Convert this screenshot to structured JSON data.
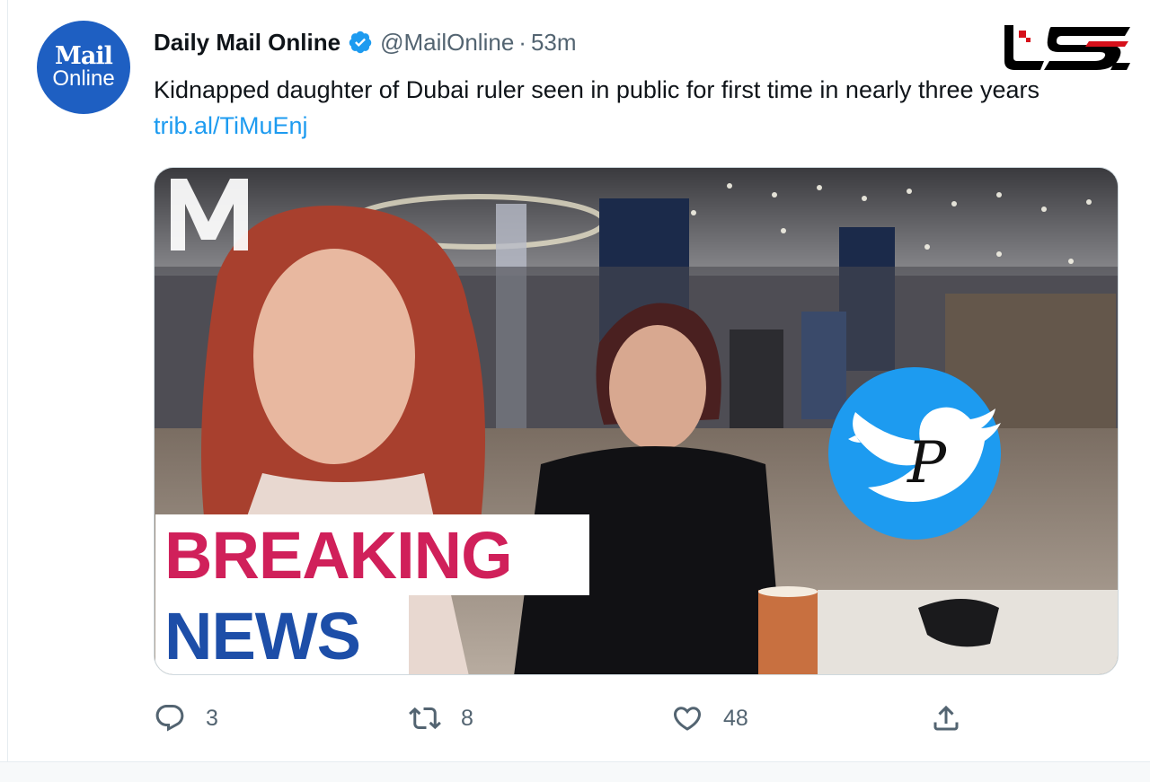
{
  "tweet": {
    "avatar": {
      "line1": "Mail",
      "line2": "Online"
    },
    "display_name": "Daily Mail Online",
    "handle": "@MailOnline",
    "separator": "·",
    "time": "53m",
    "text": "Kidnapped daughter of Dubai ruler seen in public for first time in nearly three years ",
    "link": "trib.al/TiMuEnj",
    "media": {
      "breaking_line1": "BREAKING",
      "breaking_line2": "NEWS",
      "watermark_letter": "P"
    },
    "actions": {
      "replies": "3",
      "retweets": "8",
      "likes": "48"
    }
  },
  "colors": {
    "accent": "#1d9bf0",
    "breaking_red": "#d0205a",
    "breaking_blue": "#1d4ea8",
    "mail_blue": "#1e5fc2"
  },
  "icons": [
    "verified-badge-icon",
    "reply-icon",
    "retweet-icon",
    "like-icon",
    "share-icon",
    "twitter-bird-icon"
  ]
}
